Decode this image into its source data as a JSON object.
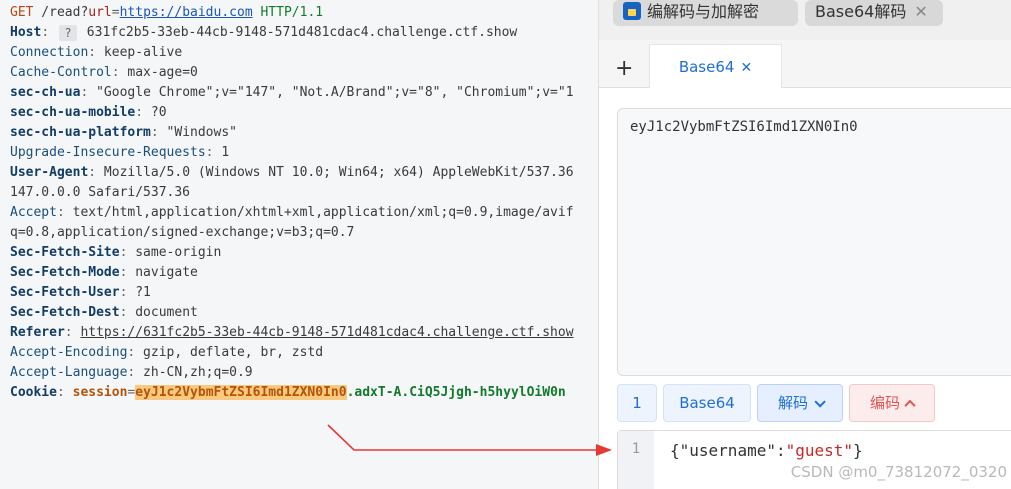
{
  "request": {
    "method": "GET",
    "path_prefix": " /read?",
    "url_key": "url",
    "url_eq": "=",
    "url_value": "https://baidu.com",
    "protocol": " HTTP/1.1",
    "headers": [
      {
        "name": "Host",
        "value": " 631fc2b5-33eb-44cb-9148-571d481cdac4.challenge.ctf.show",
        "badge": "?",
        "bold": true
      },
      {
        "name": "Connection",
        "value": " keep-alive",
        "bold": false
      },
      {
        "name": "Cache-Control",
        "value": " max-age=0",
        "bold": false
      },
      {
        "name": "sec-ch-ua",
        "value": " \"Google Chrome\";v=\"147\", \"Not.A/Brand\";v=\"8\", \"Chromium\";v=\"1",
        "bold": true
      },
      {
        "name": "sec-ch-ua-mobile",
        "value": " ?0",
        "bold": true
      },
      {
        "name": "sec-ch-ua-platform",
        "value": " \"Windows\"",
        "bold": true
      },
      {
        "name": "Upgrade-Insecure-Requests",
        "value": " 1",
        "bold": false
      },
      {
        "name": "User-Agent",
        "value": " Mozilla/5.0 (Windows NT 10.0; Win64; x64) AppleWebKit/537.36",
        "bold": false
      },
      {
        "name": "",
        "value": "147.0.0.0 Safari/537.36",
        "bold": false
      },
      {
        "name": "Accept",
        "value": " text/html,application/xhtml+xml,application/xml;q=0.9,image/avif",
        "bold": false
      },
      {
        "name": "",
        "value": "q=0.8,application/signed-exchange;v=b3;q=0.7",
        "bold": false
      },
      {
        "name": "Sec-Fetch-Site",
        "value": " same-origin",
        "bold": true
      },
      {
        "name": "Sec-Fetch-Mode",
        "value": " navigate",
        "bold": true
      },
      {
        "name": "Sec-Fetch-User",
        "value": " ?1",
        "bold": true
      },
      {
        "name": "Sec-Fetch-Dest",
        "value": " document",
        "bold": true
      },
      {
        "name": "Referer",
        "value": "https://631fc2b5-33eb-44cb-9148-571d481cdac4.challenge.ctf.show",
        "bold": true
      },
      {
        "name": "Accept-Encoding",
        "value": " gzip, deflate, br, zstd",
        "bold": false
      },
      {
        "name": "Accept-Language",
        "value": " zh-CN,zh;q=0.9",
        "bold": false
      }
    ],
    "cookie": {
      "label": "Cookie",
      "name": "session",
      "highlighted": "eyJ1c2VybmFtZSI6Imd1ZXN0In0",
      "rest": ".adxT-A.CiQ5Jjgh-h5hyylOiW0n"
    }
  },
  "tool": {
    "window_tabs": [
      {
        "label": "编解码与加解密"
      },
      {
        "label": "Base64解码"
      }
    ],
    "add_tab_label": "+",
    "active_subtab": "Base64",
    "input_text": "eyJ1c2VybmFtZSI6Imd1ZXN0In0",
    "line_number": "1",
    "format_button": "Base64",
    "decode_button": "解码",
    "encode_button": "编码",
    "output_line": "1",
    "output": {
      "open": "{",
      "key": "\"username\"",
      "colon": ":",
      "value": "\"guest\"",
      "close": "}"
    }
  },
  "watermark": "CSDN @m0_73812072_0320",
  "colors": {
    "accent": "#1e6fd9",
    "highlight": "#f9c97f",
    "arrow": "#e53935"
  }
}
